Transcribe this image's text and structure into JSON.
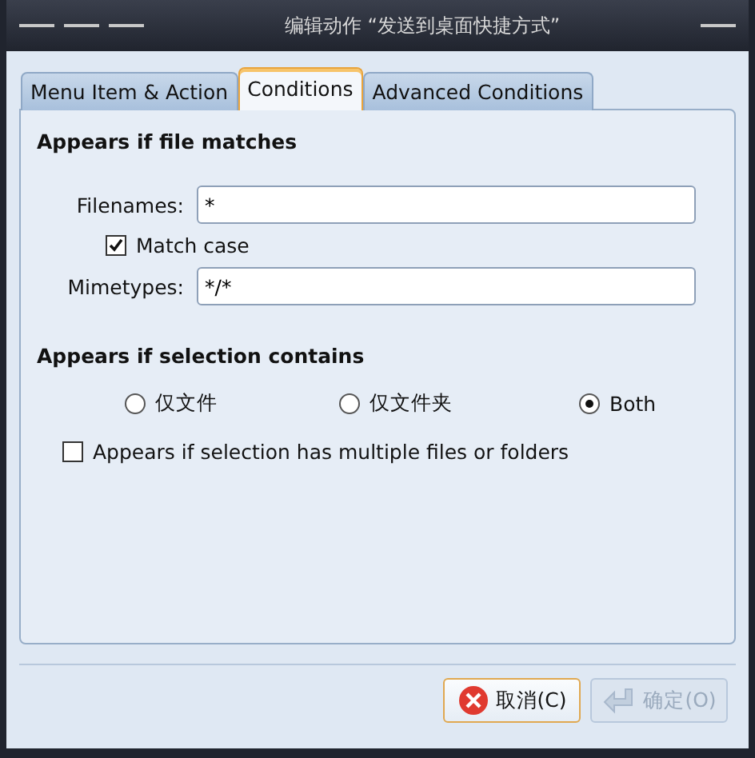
{
  "window": {
    "title": "编辑动作 “发送到桌面快捷方式”"
  },
  "tabs": [
    {
      "label": "Menu Item & Action",
      "selected": false
    },
    {
      "label": "Conditions",
      "selected": true
    },
    {
      "label": "Advanced Conditions",
      "selected": false
    }
  ],
  "file_section": {
    "heading": "Appears if file matches",
    "filenames_label": "Filenames:",
    "filenames_value": "*",
    "match_case": {
      "label": "Match case",
      "checked": true
    },
    "mimetypes_label": "Mimetypes:",
    "mimetypes_value": "*/*"
  },
  "selection_section": {
    "heading": "Appears if selection contains",
    "options": [
      {
        "label": "仅文件",
        "selected": false
      },
      {
        "label": "仅文件夹",
        "selected": false
      },
      {
        "label": "Both",
        "selected": true
      }
    ],
    "multiple": {
      "label": "Appears if selection has multiple files or folders",
      "checked": false
    }
  },
  "buttons": [
    {
      "label": "取消(C)",
      "kind": "cancel",
      "disabled": false
    },
    {
      "label": "确定(O)",
      "kind": "ok",
      "disabled": true
    }
  ]
}
